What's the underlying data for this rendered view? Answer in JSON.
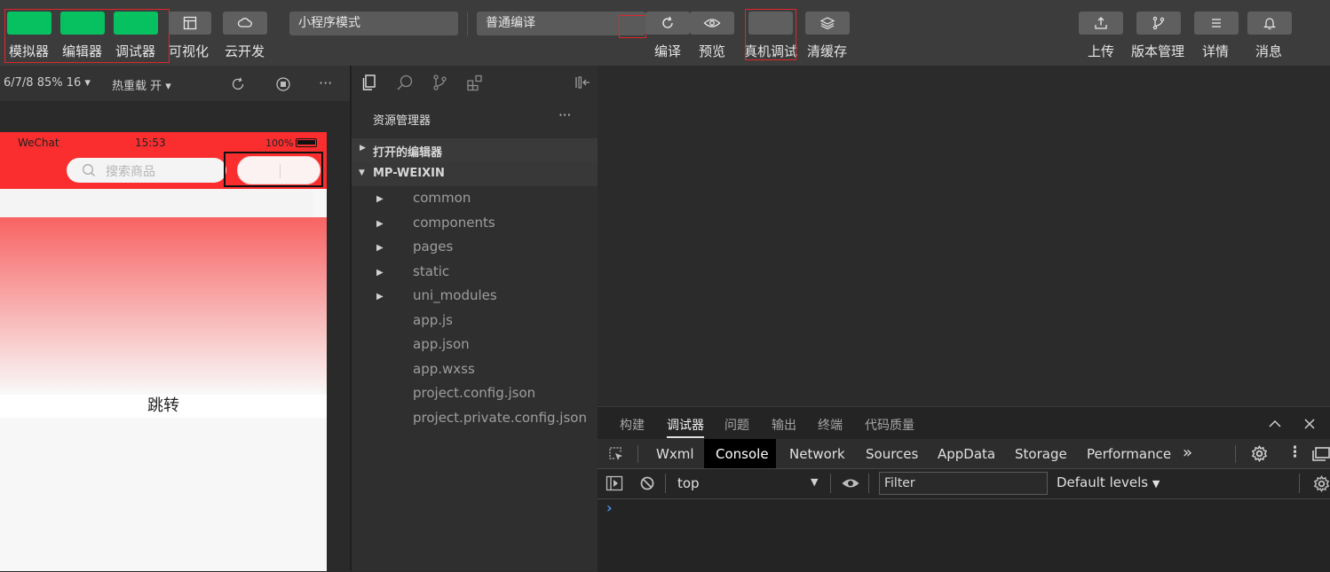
{
  "toolbar": {
    "left_buttons": [
      {
        "label": "模拟器"
      },
      {
        "label": "编辑器"
      },
      {
        "label": "调试器"
      },
      {
        "label": "可视化"
      },
      {
        "label": "云开发"
      }
    ],
    "mode_select": "小程序模式",
    "compile_select": "普通编译",
    "actions": [
      {
        "label": "编译"
      },
      {
        "label": "预览"
      },
      {
        "label": "真机调试"
      },
      {
        "label": "清缓存"
      }
    ],
    "right_buttons": [
      {
        "label": "上传"
      },
      {
        "label": "版本管理"
      },
      {
        "label": "详情"
      },
      {
        "label": "消息"
      }
    ]
  },
  "simulator": {
    "device_info": "6/7/8 85% 16",
    "hot_reload": "热重载 开",
    "more": "···",
    "status_app": "WeChat",
    "status_time": "15:53",
    "status_battery": "100%",
    "search_placeholder": "搜索商品",
    "jump_text": "跳转"
  },
  "explorer": {
    "title": "资源管理器",
    "more": "···",
    "open_editors": "打开的编辑器",
    "project": "MP-WEIXIN",
    "folders": [
      "common",
      "components",
      "pages",
      "static",
      "uni_modules"
    ],
    "files": [
      "app.js",
      "app.json",
      "app.wxss",
      "project.config.json",
      "project.private.config.json"
    ]
  },
  "debug": {
    "tabs": [
      "构建",
      "调试器",
      "问题",
      "输出",
      "终端",
      "代码质量"
    ],
    "active_tab": "调试器",
    "devtools_tabs": [
      "Wxml",
      "Console",
      "Network",
      "Sources",
      "AppData",
      "Storage",
      "Performance"
    ],
    "devtools_more": "»",
    "active_devtools_tab": "Console",
    "context": "top",
    "filter_placeholder": "Filter",
    "levels": "Default levels",
    "prompt": "›"
  },
  "colors": {
    "green": "#07c160",
    "accent_red": "#e0262a",
    "phone_header": "#fa2e2e"
  }
}
